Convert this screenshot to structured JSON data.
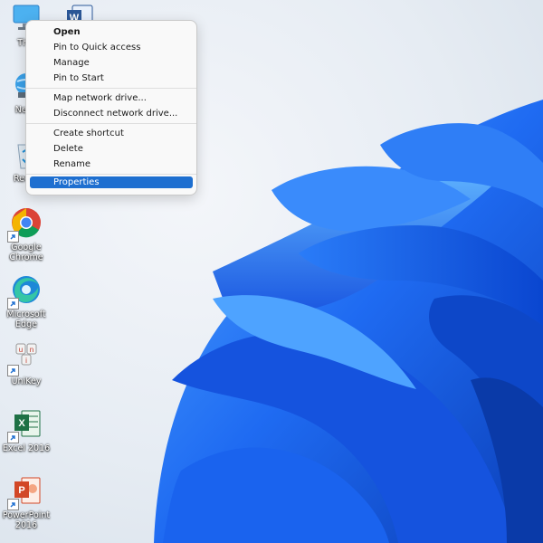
{
  "desktop": {
    "icons": [
      {
        "id": "this-pc",
        "label": "This"
      },
      {
        "id": "word",
        "label": ""
      },
      {
        "id": "network",
        "label": "Netw"
      },
      {
        "id": "recycle-bin",
        "label": "Recyc"
      },
      {
        "id": "google-chrome",
        "label": "Google\nChrome"
      },
      {
        "id": "microsoft-edge",
        "label": "Microsoft\nEdge"
      },
      {
        "id": "unikey",
        "label": "UniKey"
      },
      {
        "id": "excel-2016",
        "label": "Excel 2016"
      },
      {
        "id": "powerpoint-2016",
        "label": "PowerPoint\n2016"
      }
    ]
  },
  "context_menu": {
    "items": [
      {
        "label": "Open",
        "bold": true
      },
      {
        "label": "Pin to Quick access"
      },
      {
        "label": "Manage"
      },
      {
        "label": "Pin to Start"
      },
      {
        "separator": true
      },
      {
        "label": "Map network drive..."
      },
      {
        "label": "Disconnect network drive..."
      },
      {
        "separator": true
      },
      {
        "label": "Create shortcut"
      },
      {
        "label": "Delete"
      },
      {
        "label": "Rename"
      },
      {
        "separator": true
      },
      {
        "label": "Properties",
        "selected": true
      }
    ]
  },
  "colors": {
    "accent": "#1e6fd0",
    "wallpaper_blue": "#1a5ce6"
  }
}
